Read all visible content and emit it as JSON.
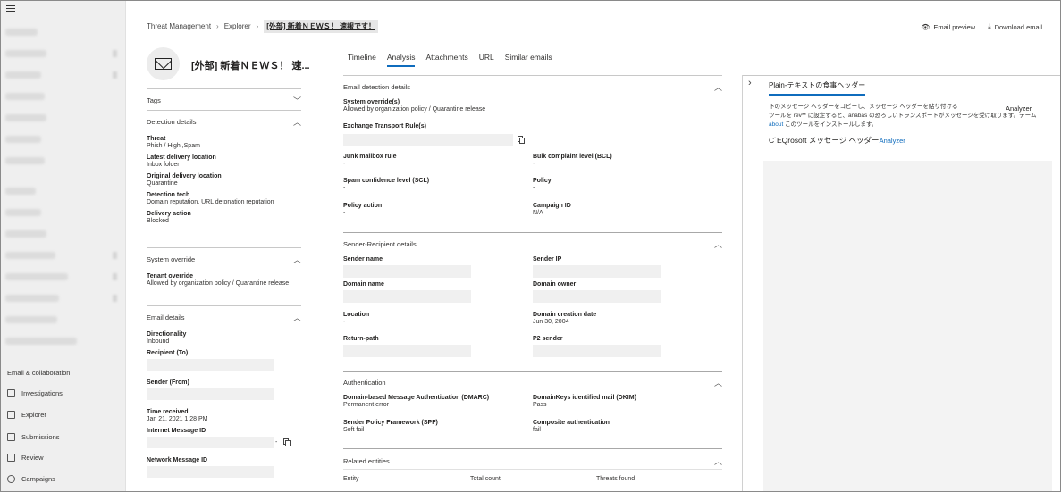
{
  "nav": {
    "section_label": "Email & collaboration",
    "items": [
      {
        "label": "Investigations",
        "icon": "investigations-icon"
      },
      {
        "label": "Explorer",
        "icon": "explorer-icon"
      },
      {
        "label": "Submissions",
        "icon": "submissions-icon"
      },
      {
        "label": "Review",
        "icon": "review-icon"
      },
      {
        "label": "Campaigns",
        "icon": "campaigns-icon"
      }
    ]
  },
  "breadcrumb": {
    "items": [
      "Threat Management",
      "Explorer"
    ],
    "current": "[外部] 新着ＮＥＷＳ！ 速報です！"
  },
  "header_actions": {
    "preview": "Email preview",
    "download": "Download email"
  },
  "summary": {
    "subject": "[外部] 新着ＮＥＷＳ！ 速...",
    "tags_label": "Tags",
    "detection": {
      "label": "Detection details",
      "fields": [
        {
          "label": "Threat",
          "value": "Phish / High ,Spam"
        },
        {
          "label": "Latest delivery location",
          "value": "Inbox folder"
        },
        {
          "label": "Original delivery location",
          "value": "Quarantine"
        },
        {
          "label": "Detection tech",
          "value": "Domain reputation, URL detonation reputation"
        },
        {
          "label": "Delivery action",
          "value": "Blocked"
        }
      ]
    },
    "override": {
      "label": "System override",
      "field_label": "Tenant override",
      "field_value": "Allowed by organization policy / Quarantine release"
    },
    "email": {
      "label": "Email details",
      "directionality_label": "Directionality",
      "directionality": "Inbound",
      "recipient_label": "Recipient (To)",
      "sender_label": "Sender (From)",
      "time_label": "Time received",
      "time": "Jan 21, 2021 1:28 PM",
      "imid_label": "Internet Message ID",
      "imid_suffix": "-",
      "nmid_label": "Network Message ID"
    }
  },
  "tabs": [
    "Timeline",
    "Analysis",
    "Attachments",
    "URL",
    "Similar emails"
  ],
  "analysis": {
    "detection": {
      "label": "Email detection details",
      "override_label": "System override(s)",
      "override_value": "Allowed by organization policy / Quarantine release",
      "transport_label": "Exchange Transport Rule(s)",
      "rows": [
        {
          "label": "Junk mailbox rule",
          "value": "-"
        },
        {
          "label": "Bulk complaint level (BCL)",
          "value": "-"
        },
        {
          "label": "Spam confidence level (SCL)",
          "value": "-"
        },
        {
          "label": "Policy",
          "value": "-"
        },
        {
          "label": "Policy action",
          "value": "-"
        },
        {
          "label": "Campaign ID",
          "value": "N/A"
        }
      ]
    },
    "sender": {
      "label": "Sender-Recipient details",
      "sender_name": "Sender name",
      "sender_ip": "Sender IP",
      "domain_name": "Domain name",
      "domain_owner": "Domain owner",
      "location_label": "Location",
      "location": "-",
      "creation_label": "Domain creation date",
      "creation": "Jun 30, 2004",
      "return_path": "Return-path",
      "p2_label": "P2 sender",
      "p2_value": "-"
    },
    "auth": {
      "label": "Authentication",
      "dmarc_label": "Domain-based Message Authentication (DMARC)",
      "dmarc": "Permanent error",
      "dkim_label": "DomainKeys identified mail (DKIM)",
      "dkim": "Pass",
      "spf_label": "Sender Policy Framework (SPF)",
      "spf": "Soft fail",
      "composite_label": "Composite authentication",
      "composite": "fail"
    },
    "entities": {
      "label": "Related entities",
      "columns": [
        "Entity",
        "Total count",
        "Threats found"
      ]
    }
  },
  "pane": {
    "tab": "Plain-テキストの食事ヘッダー",
    "line1": "下のメッセージ ヘッダーをコピーし、メッセージ ヘッダーを貼り付ける",
    "line2": "ツールを rev** に設定すると、anabas の恐ろしいトランスポートがメッセージを受け取ります。テーム",
    "link": "about",
    "line3": " このツールをインストールします。",
    "analyzer": "Analyzer",
    "line4": "C`EQrosoft メッセージ ヘッダー",
    "line4_link": "Analyzer"
  }
}
